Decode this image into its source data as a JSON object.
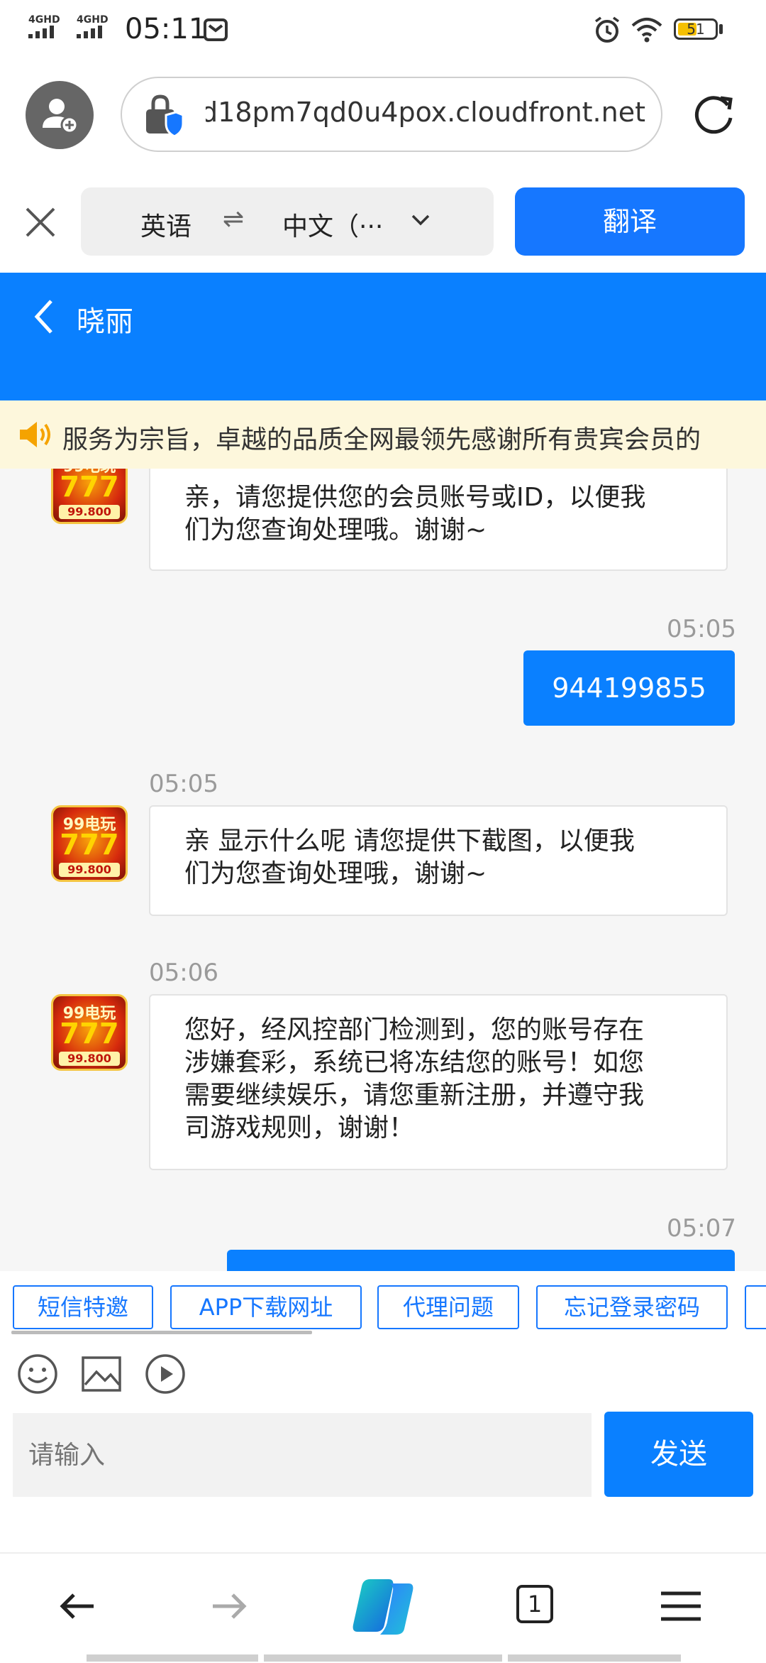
{
  "status_bar": {
    "sim1": "4GHD",
    "sim2": "4GHD",
    "time": "05:11",
    "battery": "51",
    "battery_level": 0.51
  },
  "browser": {
    "url": "d18pm7qd0u4pox.cloudfront.net",
    "icons": {
      "account": "add-account-icon",
      "site": "shield-lock-icon",
      "reload": "reload-icon"
    }
  },
  "translate_bar": {
    "source_lang": "英语",
    "swap": "⇌",
    "target_lang": "中文（···",
    "translate_label": "翻译"
  },
  "chat": {
    "back_icon": "back-chevron-icon",
    "title": "晓丽",
    "notice": "服务为宗旨，卓越的品质全网最领先感谢所有贵宾会员的",
    "avatar_logo": {
      "top": "99电玩",
      "mid": "777",
      "bottom": "99.800"
    },
    "messages": [
      {
        "from": "agent",
        "time": "",
        "text_lines": [
          "亲，请您提供您的会员账号或ID，以便我",
          "们为您查询处理哦。谢谢~"
        ]
      },
      {
        "from": "user",
        "time": "05:05",
        "text": "944199855"
      },
      {
        "from": "agent",
        "time": "05:05",
        "text_lines": [
          "亲 显示什么呢 请您提供下截图，以便我",
          "们为您查询处理哦，谢谢~"
        ]
      },
      {
        "from": "agent",
        "time": "05:06",
        "text_lines": [
          "您好，经风控部门检测到，您的账号存在",
          "涉嫌套彩，系统已将冻结您的账号！如您",
          "需要继续娱乐，请您重新注册，并遵守我",
          "司游戏规则，谢谢！"
        ]
      },
      {
        "from": "user",
        "time": "05:07",
        "text": ""
      }
    ],
    "quick_replies": [
      "短信特邀",
      "APP下载网址",
      "代理问题",
      "忘记登录密码"
    ],
    "tools": [
      "emoji-icon",
      "image-icon",
      "video-icon"
    ],
    "input_placeholder": "请输入",
    "send_label": "发送"
  },
  "bottom_nav": {
    "tab_count": "1",
    "icons": [
      "back-arrow-icon",
      "forward-arrow-icon",
      "copilot-icon",
      "tabs-icon",
      "menu-icon"
    ]
  }
}
